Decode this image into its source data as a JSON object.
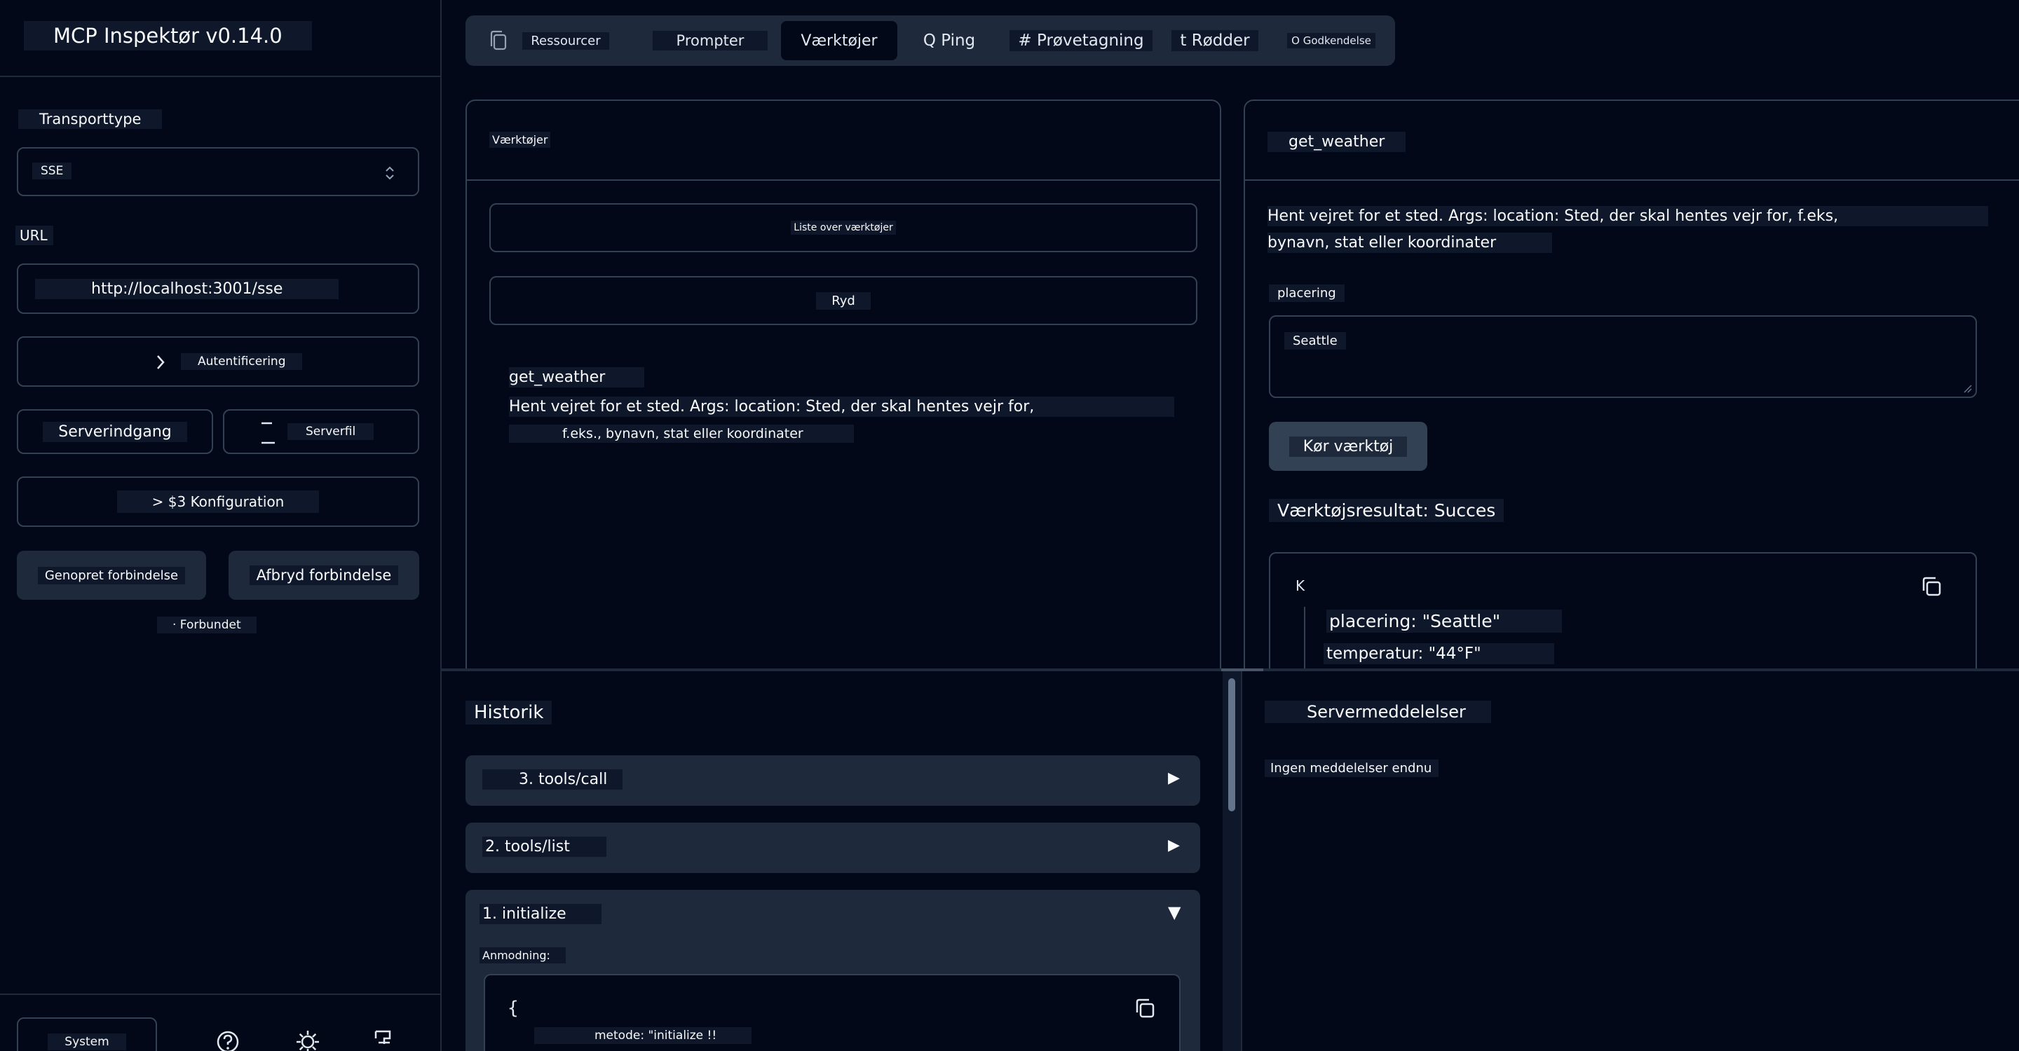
{
  "app": {
    "title": "MCP Inspektør v0.14.0"
  },
  "sidebar": {
    "transport_label": "Transporttype",
    "transport_value": "SSE",
    "url_label": "URL",
    "url_value": "http://localhost:3001/sse",
    "auth_label": "Autentificering",
    "server_entry_label": "Serverindgang",
    "server_file_label": "Serverfil",
    "config_label": "> $3 Konfiguration",
    "reconnect_label": "Genopret forbindelse",
    "disconnect_label": "Afbryd forbindelse",
    "status_text": "· Forbundet",
    "theme_label": "System"
  },
  "tabs": [
    {
      "label": "Ressourcer",
      "active": false
    },
    {
      "label": "Prompter",
      "active": false
    },
    {
      "label": "Værktøjer",
      "active": true
    },
    {
      "label": "Q Ping",
      "active": false
    },
    {
      "label": "# Prøvetagning",
      "active": false
    },
    {
      "label": "t Rødder",
      "active": false
    },
    {
      "label": "O Godkendelse",
      "active": false
    }
  ],
  "tools_panel": {
    "title": "Værktøjer",
    "list_button": "Liste over værktøjer",
    "clear_button": "Ryd",
    "items": [
      {
        "name": "get_weather",
        "description_1": "Hent vejret for et sted. Args: location: Sted, der skal hentes vejr for,",
        "description_2": "f.eks., bynavn, stat eller koordinater"
      }
    ]
  },
  "tool_detail": {
    "title": "get_weather",
    "description_1": "Hent vejret for et sted. Args: location: Sted, der skal hentes vejr for, f.eks,",
    "description_2": "bynavn, stat eller koordinater",
    "param_label": "placering",
    "param_value": "Seattle",
    "run_button": "Kør værktøj",
    "result_label": "Værktøjsresultat: Succes",
    "result_open": "K",
    "result_lines": [
      "placering: \"Seattle\"",
      "temperatur: \"44°F\""
    ]
  },
  "history": {
    "title": "Historik",
    "items": [
      {
        "label": "3. tools/call",
        "arrow": "▶"
      },
      {
        "label": "2. tools/list",
        "arrow": "▶"
      },
      {
        "label": "1. initialize",
        "arrow": "▼"
      }
    ],
    "request_label": "Anmodning:",
    "code_open": "{",
    "code_line": "metode: \"initialize !!"
  },
  "notifications": {
    "title": "Servermeddelelser",
    "empty_text": "Ingen meddelelser endnu"
  },
  "colors": {
    "background": "#020817",
    "surface": "#1e293b",
    "border": "#334155",
    "text": "#f8fafc"
  }
}
